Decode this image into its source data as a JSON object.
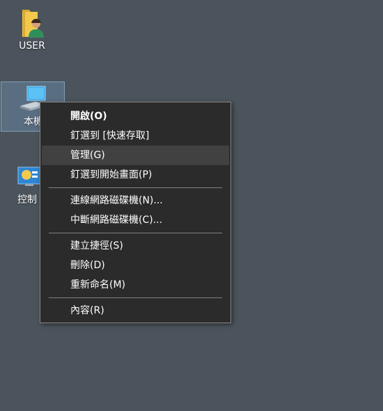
{
  "desktop": {
    "icons": [
      {
        "label": "USER",
        "icon": "user-folder-icon"
      },
      {
        "label": "本機",
        "icon": "computer-icon"
      },
      {
        "label": "控制",
        "icon": "control-panel-icon"
      }
    ]
  },
  "context_menu": {
    "groups": [
      [
        {
          "label": "開啟(O)",
          "default": true
        },
        {
          "label": "釘選到 [快速存取]"
        },
        {
          "label": "管理(G)",
          "highlighted": true
        },
        {
          "label": "釘選到開始畫面(P)"
        }
      ],
      [
        {
          "label": "連線網路磁碟機(N)..."
        },
        {
          "label": "中斷網路磁碟機(C)..."
        }
      ],
      [
        {
          "label": "建立捷徑(S)"
        },
        {
          "label": "刪除(D)"
        },
        {
          "label": "重新命名(M)"
        }
      ],
      [
        {
          "label": "內容(R)"
        }
      ]
    ]
  },
  "colors": {
    "desktop_bg": "#4b545c",
    "menu_bg": "#2b2b2b",
    "menu_hover": "#414141",
    "menu_border": "#8a8a8a"
  }
}
